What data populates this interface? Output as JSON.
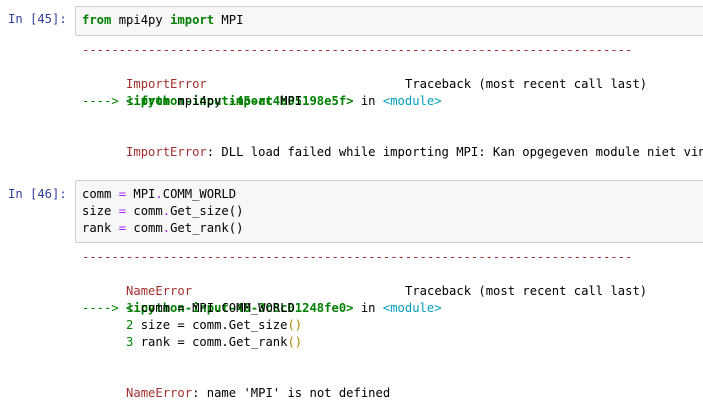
{
  "cells": [
    {
      "prompt": "In [45]:",
      "code": [
        [
          {
            "t": "from",
            "c": "kw"
          },
          {
            "t": " mpi4py ",
            "c": "default"
          },
          {
            "t": "import",
            "c": "kw"
          },
          {
            "t": " MPI",
            "c": "default"
          }
        ]
      ],
      "output": {
        "dashes": "---------------------------------------------------------------------------",
        "error_type": "ImportError",
        "traceback_label": "Traceback (most recent call last)",
        "input_ref": "<ipython-input-45-ac4b05198e5f>",
        "in_word": " in ",
        "module_ref": "<module>",
        "trace_lines": [
          [
            {
              "t": "----> 1 ",
              "c": "arrow"
            },
            {
              "t": "from",
              "c": "kw"
            },
            {
              "t": " mpi4py ",
              "c": "default"
            },
            {
              "t": "import",
              "c": "kw"
            },
            {
              "t": " MPI",
              "c": "default"
            }
          ]
        ],
        "error_message": ": DLL load failed while importing MPI: Kan opgegeven module niet vinden."
      }
    },
    {
      "prompt": "In [46]:",
      "code": [
        [
          {
            "t": "comm ",
            "c": "default"
          },
          {
            "t": "=",
            "c": "op"
          },
          {
            "t": " MPI",
            "c": "default"
          },
          {
            "t": ".",
            "c": "op"
          },
          {
            "t": "COMM_WORLD",
            "c": "default"
          }
        ],
        [
          {
            "t": "size ",
            "c": "default"
          },
          {
            "t": "=",
            "c": "op"
          },
          {
            "t": " comm",
            "c": "default"
          },
          {
            "t": ".",
            "c": "op"
          },
          {
            "t": "Get_size()",
            "c": "default"
          }
        ],
        [
          {
            "t": "rank ",
            "c": "default"
          },
          {
            "t": "=",
            "c": "op"
          },
          {
            "t": " comm",
            "c": "default"
          },
          {
            "t": ".",
            "c": "op"
          },
          {
            "t": "Get_rank()",
            "c": "default"
          }
        ]
      ],
      "output": {
        "dashes": "---------------------------------------------------------------------------",
        "error_type": "NameError",
        "traceback_label": "Traceback (most recent call last)",
        "input_ref": "<ipython-input-46-3c8c01248fe0>",
        "in_word": " in ",
        "module_ref": "<module>",
        "trace_lines": [
          [
            {
              "t": "----> 1 ",
              "c": "arrow"
            },
            {
              "t": "comm ",
              "c": "default"
            },
            {
              "t": "=",
              "c": "default"
            },
            {
              "t": " MPI",
              "c": "default"
            },
            {
              "t": ".",
              "c": "default"
            },
            {
              "t": "COMM_WORLD",
              "c": "default"
            }
          ],
          [
            {
              "t": "      2 ",
              "c": "lineno"
            },
            {
              "t": "size ",
              "c": "default"
            },
            {
              "t": "=",
              "c": "default"
            },
            {
              "t": " comm",
              "c": "default"
            },
            {
              "t": ".",
              "c": "default"
            },
            {
              "t": "Get_size",
              "c": "default"
            },
            {
              "t": "()",
              "c": "paren"
            }
          ],
          [
            {
              "t": "      3 ",
              "c": "lineno"
            },
            {
              "t": "rank ",
              "c": "default"
            },
            {
              "t": "=",
              "c": "default"
            },
            {
              "t": " comm",
              "c": "default"
            },
            {
              "t": ".",
              "c": "default"
            },
            {
              "t": "Get_rank",
              "c": "default"
            },
            {
              "t": "()",
              "c": "paren"
            }
          ]
        ],
        "error_message": ": name 'MPI' is not defined"
      }
    }
  ]
}
